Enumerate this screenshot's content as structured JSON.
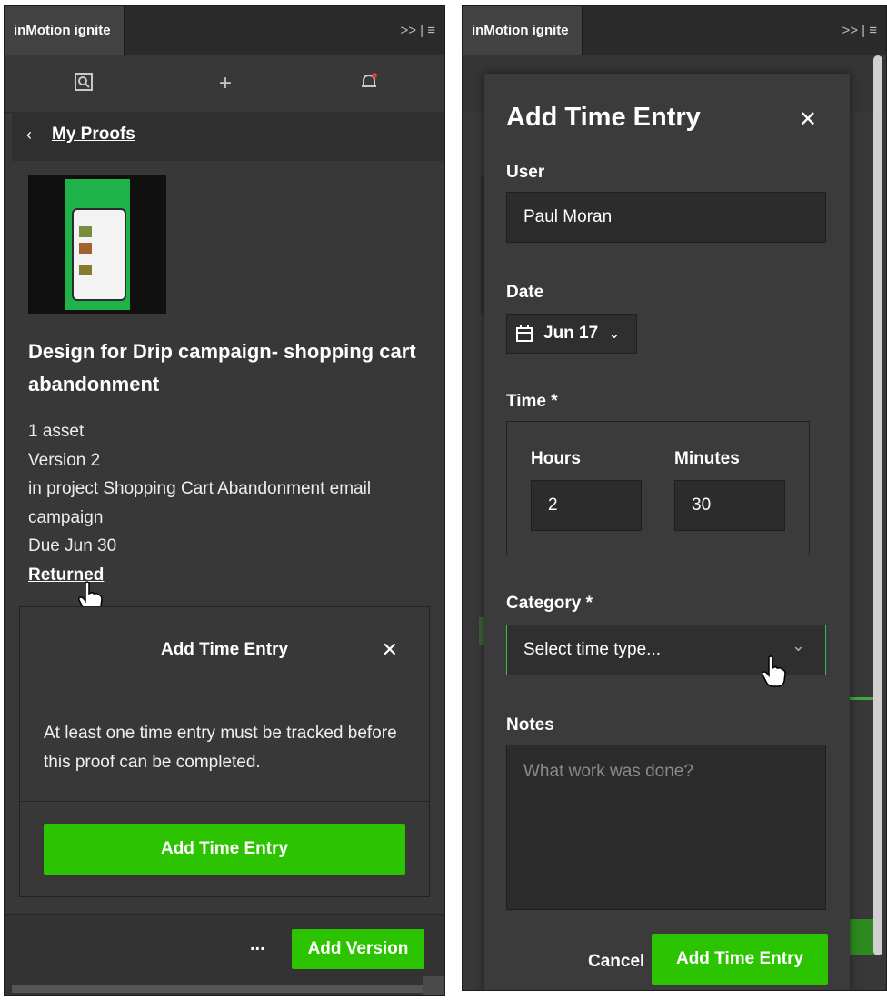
{
  "left": {
    "tab_title": "inMotion ignite",
    "tab_controls": ">> | ≡",
    "back_link": "My Proofs",
    "proof_title": "Design for Drip campaign- shopping cart abandonment",
    "assets": "1 asset",
    "version": "Version 2",
    "project": "in project Shopping Cart Abandonment email campaign",
    "due": "Due Jun 30",
    "status": "Returned",
    "card": {
      "title": "Add Time Entry",
      "message": "At least one time entry must be tracked before this proof can be completed.",
      "button": "Add Time Entry"
    },
    "footer": {
      "more": "...",
      "add_version": "Add Version"
    }
  },
  "right": {
    "tab_title": "inMotion ignite",
    "tab_controls": ">> | ≡",
    "dialog": {
      "title": "Add Time Entry",
      "user_label": "User",
      "user_value": "Paul Moran",
      "date_label": "Date",
      "date_value": "Jun 17",
      "time_label": "Time *",
      "hours_label": "Hours",
      "hours_value": "2",
      "minutes_label": "Minutes",
      "minutes_value": "30",
      "category_label": "Category *",
      "category_placeholder": "Select time type...",
      "notes_label": "Notes",
      "notes_placeholder": "What work was done?",
      "cancel": "Cancel",
      "submit": "Add Time Entry"
    }
  },
  "colors": {
    "accent_green": "#2cc400",
    "panel_bg": "#383838",
    "dark_bg": "#2b2b2b",
    "focus_border": "#33c33a"
  }
}
